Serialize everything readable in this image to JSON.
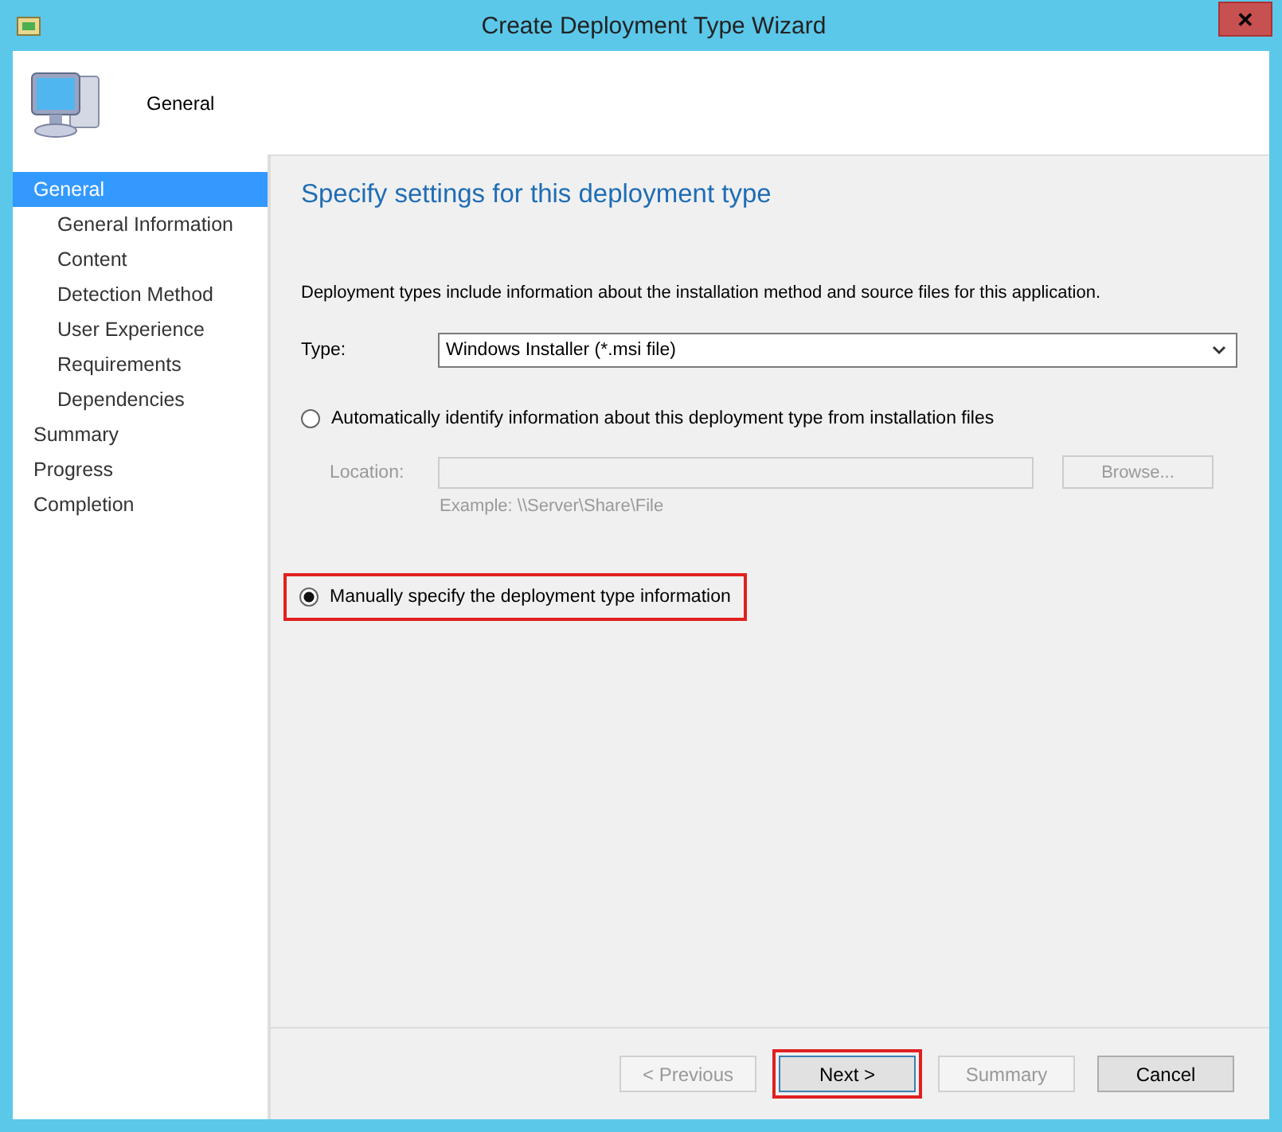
{
  "window": {
    "title": "Create Deployment Type Wizard",
    "close": "✕"
  },
  "header": {
    "title": "General"
  },
  "sidebar": {
    "items": [
      {
        "label": "General",
        "selected": true,
        "children": [
          {
            "label": "General Information",
            "selected": false
          },
          {
            "label": "Content",
            "selected": false
          },
          {
            "label": "Detection Method",
            "selected": false
          },
          {
            "label": "User Experience",
            "selected": false
          },
          {
            "label": "Requirements",
            "selected": false
          },
          {
            "label": "Dependencies",
            "selected": false
          }
        ]
      },
      {
        "label": "Summary",
        "selected": false
      },
      {
        "label": "Progress",
        "selected": false
      },
      {
        "label": "Completion",
        "selected": false
      }
    ]
  },
  "content": {
    "heading": "Specify settings for this deployment type",
    "description": "Deployment types include information about the installation method and source files for this application.",
    "type_label": "Type:",
    "type_value": "Windows Installer (*.msi file)",
    "options": [
      {
        "label": "Automatically identify information about this deployment type from installation files",
        "selected": false,
        "highlighted": false
      },
      {
        "label": "Manually specify the deployment type information",
        "selected": true,
        "highlighted": true
      }
    ],
    "location_label": "Location:",
    "location_disabled": true,
    "browse": "Browse...",
    "example": "Example: \\\\Server\\Share\\File"
  },
  "buttons": [
    {
      "label": "< Previous",
      "disabled": true,
      "highlighted": false,
      "default": false
    },
    {
      "label": "Next >",
      "disabled": false,
      "highlighted": true,
      "default": true
    },
    {
      "label": "Summary",
      "disabled": true,
      "highlighted": false,
      "default": false
    },
    {
      "label": "Cancel",
      "disabled": false,
      "highlighted": false,
      "default": false
    }
  ]
}
